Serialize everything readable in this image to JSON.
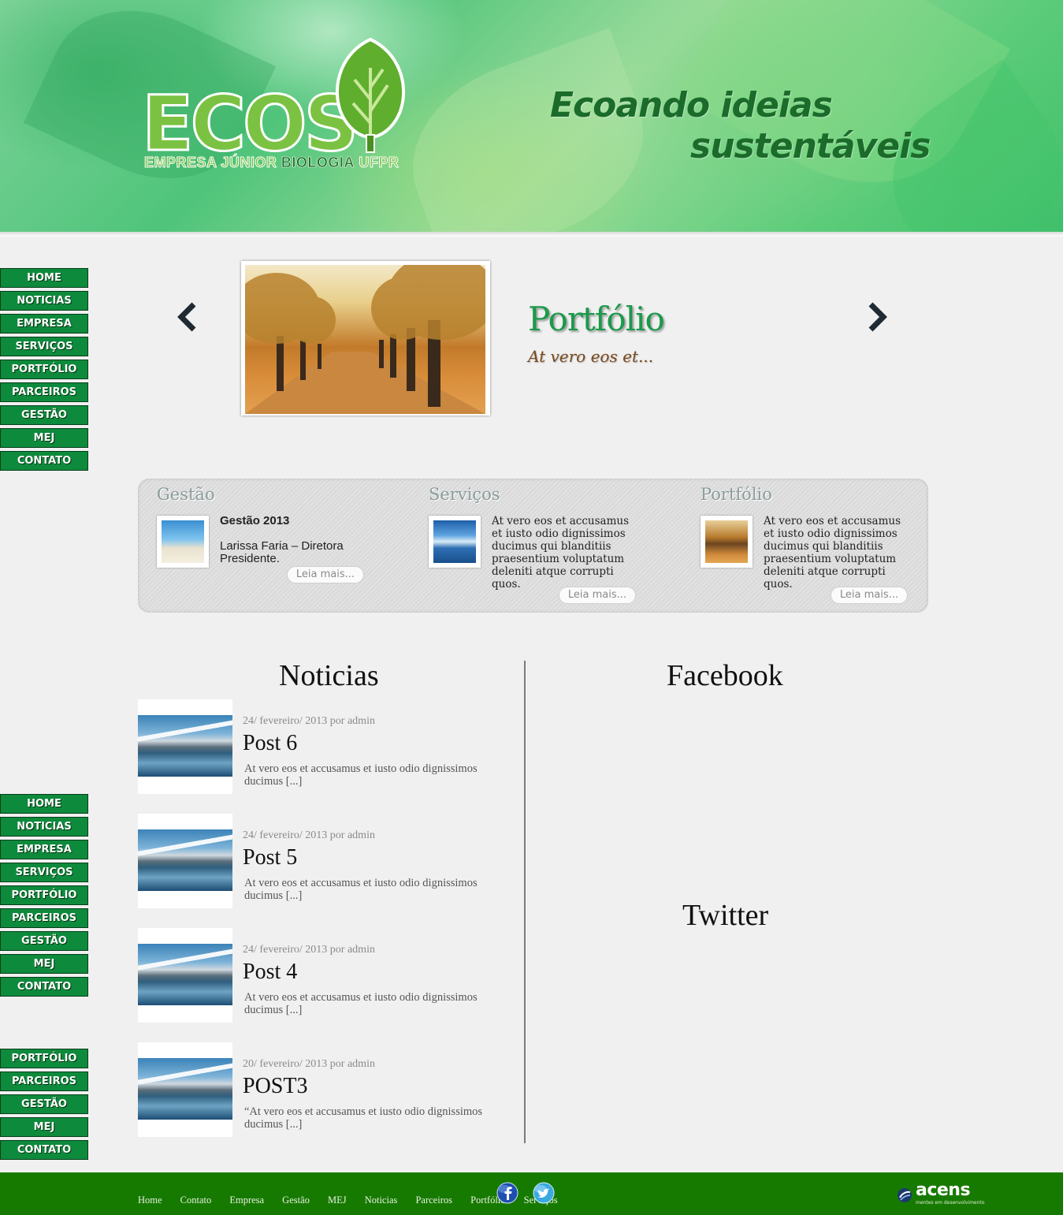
{
  "header": {
    "logo_main": "ECOS",
    "logo_sub_a": "EMPRESA JÚNIOR ",
    "logo_sub_b": "BIOLOGIA",
    "logo_sub_c": " UFPR",
    "tagline_line1": "Ecoando ideias",
    "tagline_line2": "sustentáveis"
  },
  "nav": [
    "HOME",
    "NOTICIAS",
    "EMPRESA",
    "SERVIÇOS",
    "PORTFÓLIO",
    "PARCEIROS",
    "GESTÃO",
    "MEJ",
    "CONTATO"
  ],
  "nav_partial": [
    "PORTFÓLIO",
    "PARCEIROS",
    "GESTÃO",
    "MEJ",
    "CONTATO"
  ],
  "slider": {
    "title": "Portfólio",
    "subtitle": "At vero eos et..."
  },
  "features": [
    {
      "heading": "Gestão",
      "item_title": "Gestão 2013",
      "item_text": "Larissa Faria – Diretora Presidente.",
      "more": "Leia mais..."
    },
    {
      "heading": "Serviços",
      "item_text": "At vero eos et accusamus et iusto odio dignissimos ducimus qui blanditiis praesentium voluptatum deleniti atque corrupti quos.",
      "more": "Leia mais..."
    },
    {
      "heading": "Portfólio",
      "item_text": "At vero eos et accusamus et iusto odio dignissimos ducimus qui blanditiis praesentium voluptatum deleniti atque corrupti quos.",
      "more": "Leia mais..."
    }
  ],
  "news": {
    "title": "Noticias",
    "posts": [
      {
        "meta": "24/ fevereiro/ 2013 por admin",
        "title": "Post 6",
        "excerpt": "At vero eos et accusamus et iusto odio dignissimos ducimus [...]"
      },
      {
        "meta": "24/ fevereiro/ 2013 por admin",
        "title": "Post 5",
        "excerpt": "At vero eos et accusamus et iusto odio dignissimos ducimus [...]"
      },
      {
        "meta": "24/ fevereiro/ 2013 por admin",
        "title": "Post 4",
        "excerpt": "At vero eos et accusamus et iusto odio dignissimos ducimus [...]"
      },
      {
        "meta": "20/ fevereiro/ 2013 por admin",
        "title": "POST3",
        "excerpt": "“At vero eos et accusamus et iusto odio dignissimos ducimus [...]"
      }
    ]
  },
  "facebook_title": "Facebook",
  "twitter_title": "Twitter",
  "footer": {
    "links": [
      "Home",
      "Contato",
      "Empresa",
      "Gestão",
      "MEJ",
      "Noticias",
      "Parceiros",
      "Portfólio",
      "Serviços"
    ],
    "brand": "acens",
    "brand_tag": "mentes em desenvolvimento"
  },
  "colors": {
    "nav_bg": "#0e8a3c",
    "footer_bg": "#177a00",
    "accent_green": "#1a9a4a"
  },
  "icons": [
    "prev-arrow-icon",
    "next-arrow-icon",
    "facebook-icon",
    "twitter-icon"
  ]
}
